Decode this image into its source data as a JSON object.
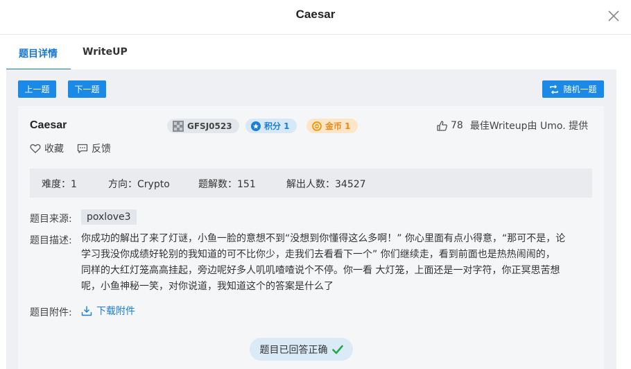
{
  "modal": {
    "title": "Caesar"
  },
  "tabs": [
    {
      "label": "题目详情",
      "active": true
    },
    {
      "label": "WriteUP",
      "active": false
    }
  ],
  "toolbar": {
    "prev_label": "上一题",
    "next_label": "下一题",
    "random_label": "随机一题"
  },
  "question": {
    "title": "Caesar",
    "author": "GFSJ0523",
    "score_label": "积分 1",
    "coin_label": "金币 1",
    "likes": "78",
    "best_writeup": "最佳Writeup由 Umo. 提供",
    "favorite_label": "收藏",
    "feedback_label": "反馈",
    "stats": {
      "difficulty": "难度：1",
      "direction": "方向：Crypto",
      "solves": "题解数：151",
      "solvers": "解出人数：34527"
    },
    "source_label": "题目来源:",
    "source_value": "poxlove3",
    "desc_label": "题目描述:",
    "desc_lines": [
      "你成功的解出了来了灯谜，小鱼一脸的意想不到“没想到你懂得这么多啊！” 你心里面有点小得意，“那可不是，论",
      "学习我没你成绩好轮别的我知道的可不比你少，走我们去看看下一个” 你们继续走，看到前面也是热热闹闹的，",
      "同样的大红灯笼高高挂起，旁边呢好多人叽叽喳喳说个不停。你一看 大灯笼，上面还是一对字符，你正冥思苦想",
      "呢，小鱼神秘一笑，对你说道，我知道这个的答案是什么了"
    ],
    "attachment_label": "题目附件:",
    "download_label": "下载附件",
    "solved_label": "题目已回答正确"
  },
  "colors": {
    "accent": "#1677d2",
    "button": "#1b8ae6",
    "coin": "#e8891a",
    "success": "#23a84a"
  },
  "icons": [
    "close-icon",
    "shuffle-icon",
    "avatar-icon",
    "star-icon",
    "coin-icon",
    "thumbs-up-icon",
    "heart-icon",
    "comment-icon",
    "download-icon",
    "checkmark-icon"
  ]
}
